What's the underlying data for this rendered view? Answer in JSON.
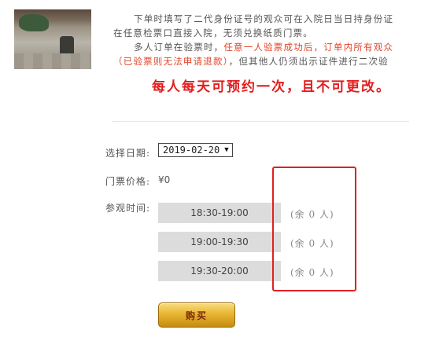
{
  "intro": {
    "line1": "下单时填写了二代身份证号的观众可在入院日当日持身份证",
    "line2": "在任意检票口直接入院，无须兑换纸质门票。",
    "line3_normal": "多人订单在验票时，",
    "line3_red": "任意一人验票成功后，订单内所有观众",
    "line4_red": "（已验票则无法申请退款）",
    "line4_normal": "，但其他人仍须出示证件进行二次验",
    "notice": "每人每天可预约一次，且不可更改。"
  },
  "form": {
    "date_label": "选择日期:",
    "date_value": "2019-02-20",
    "price_label": "门票价格:",
    "price_value": "¥0",
    "time_label": "参观时间:",
    "slots": [
      {
        "time": "18:30-19:00",
        "remaining": "(余 0 人)"
      },
      {
        "time": "19:00-19:30",
        "remaining": "(余 0 人)"
      },
      {
        "time": "19:30-20:00",
        "remaining": "(余 0 人)"
      }
    ],
    "buy_label": "购买"
  },
  "colors": {
    "notice_red": "#e21d1d",
    "highlight_red": "#e02020",
    "slot_bg": "#dcdcdc",
    "button_gold": "#e8b532"
  }
}
